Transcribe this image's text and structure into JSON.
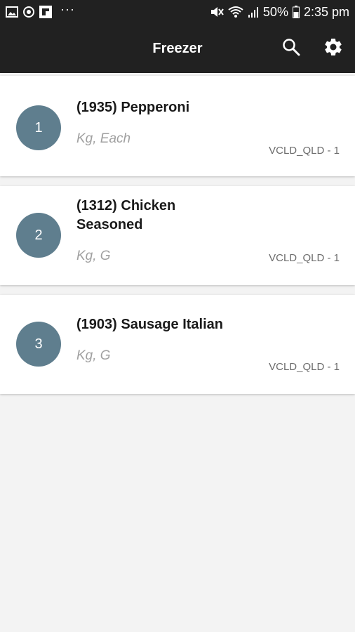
{
  "status_bar": {
    "battery_percent": "50%",
    "time": "2:35 pm",
    "more_indicator": "···",
    "left_icons": [
      "image-icon",
      "sync-icon",
      "flipboard-icon"
    ],
    "right_icons": [
      "mute-icon",
      "wifi-icon",
      "signal-icon",
      "battery-icon"
    ]
  },
  "app_bar": {
    "title": "Freezer",
    "actions": [
      "search-icon",
      "settings-icon"
    ],
    "background": "#212121"
  },
  "items": [
    {
      "index": "1",
      "title": "(1935) Pepperoni",
      "units": "Kg, Each",
      "code": "VCLD_QLD - 1"
    },
    {
      "index": "2",
      "title": "(1312) Chicken Seasoned",
      "units": "Kg, G",
      "code": "VCLD_QLD - 1"
    },
    {
      "index": "3",
      "title": "(1903) Sausage Italian",
      "units": "Kg, G",
      "code": "VCLD_QLD - 1"
    }
  ],
  "colors": {
    "avatar": "#5f7e8e",
    "background": "#f3f3f3",
    "card": "#ffffff"
  }
}
